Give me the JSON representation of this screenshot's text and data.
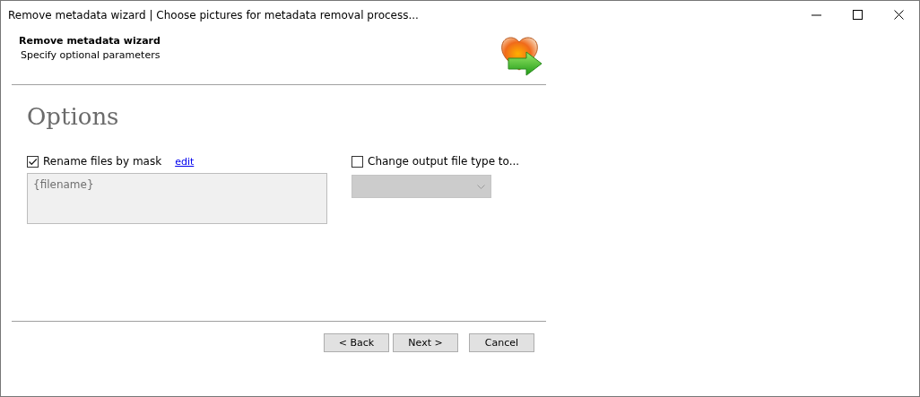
{
  "window": {
    "title": "Remove metadata wizard | Choose pictures for metadata removal process..."
  },
  "header": {
    "title": "Remove metadata wizard",
    "subtitle": "Specify optional parameters"
  },
  "section_title": "Options",
  "rename": {
    "label": "Rename files by mask",
    "checked": true,
    "link": "edit",
    "mask_field": {
      "value": "{filename}",
      "disabled": true
    }
  },
  "output_type": {
    "label": "Change output file type to...",
    "checked": false,
    "dropdown": {
      "disabled": true
    }
  },
  "buttons": [
    {
      "label": "< Back"
    },
    {
      "label": "Next >"
    },
    {
      "label": "Cancel"
    }
  ]
}
